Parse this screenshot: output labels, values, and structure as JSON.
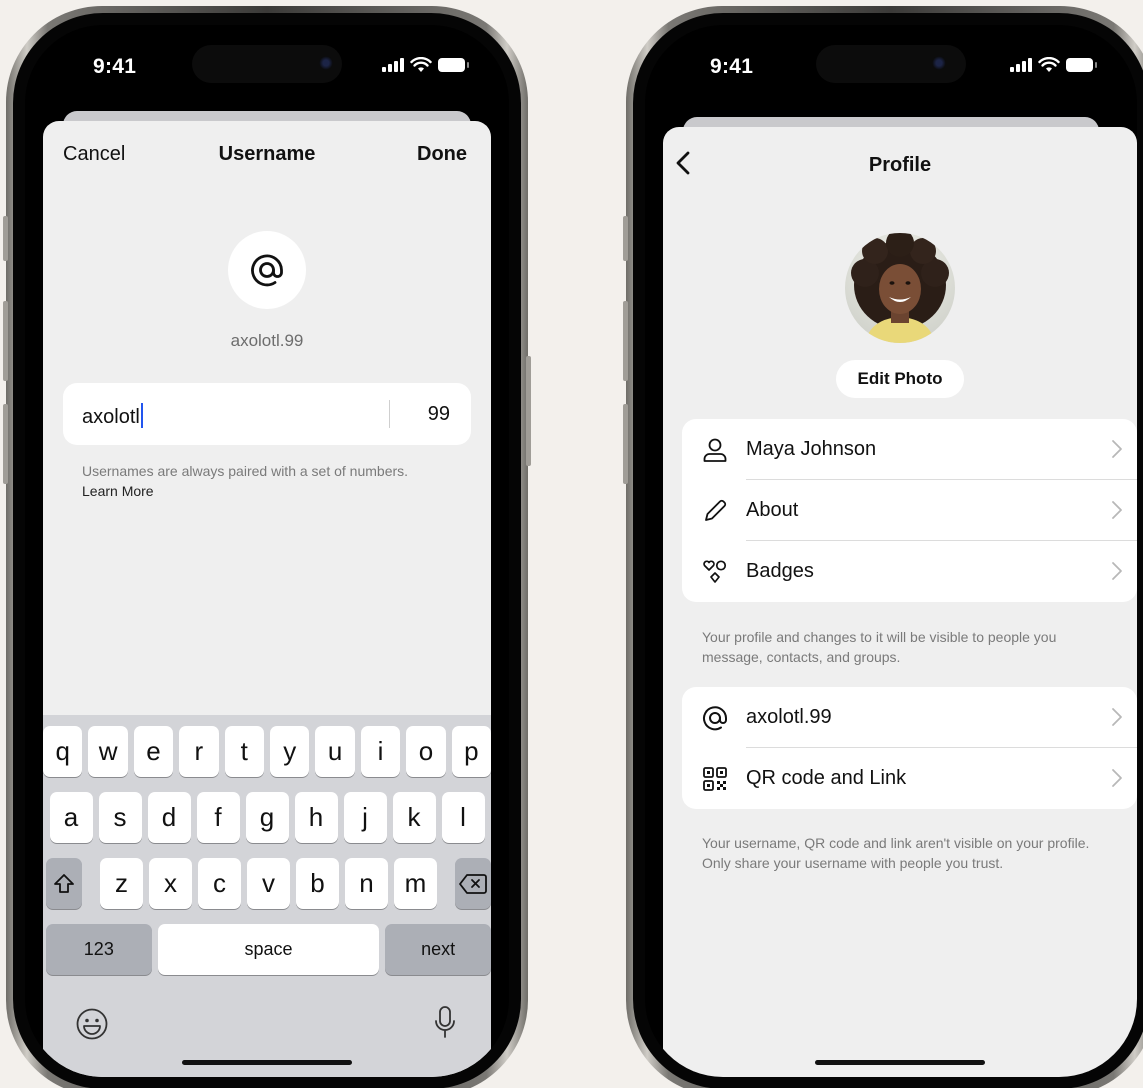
{
  "left_phone": {
    "status": {
      "time": "9:41"
    },
    "nav": {
      "cancel": "Cancel",
      "title": "Username",
      "done": "Done"
    },
    "username_display": "axolotl.99",
    "input": {
      "value": "axolotl",
      "number": "99"
    },
    "hint": {
      "text": "Usernames are always paired with a set of numbers.",
      "link": "Learn More"
    },
    "keyboard": {
      "row1": [
        "q",
        "w",
        "e",
        "r",
        "t",
        "y",
        "u",
        "i",
        "o",
        "p"
      ],
      "row2": [
        "a",
        "s",
        "d",
        "f",
        "g",
        "h",
        "j",
        "k",
        "l"
      ],
      "row3": [
        "z",
        "x",
        "c",
        "v",
        "b",
        "n",
        "m"
      ],
      "numbers_key": "123",
      "space_key": "space",
      "next_key": "next"
    }
  },
  "right_phone": {
    "status": {
      "time": "9:41"
    },
    "nav": {
      "title": "Profile"
    },
    "edit_photo": "Edit Photo",
    "profile_items": [
      {
        "label": "Maya Johnson",
        "icon": "person-icon"
      },
      {
        "label": "About",
        "icon": "pencil-icon"
      },
      {
        "label": "Badges",
        "icon": "badges-icon"
      }
    ],
    "profile_note": "Your profile and changes to it will be visible to people you message, contacts, and groups.",
    "username_items": [
      {
        "label": "axolotl.99",
        "icon": "at-icon"
      },
      {
        "label": "QR code and Link",
        "icon": "qr-code-icon"
      }
    ],
    "username_note": "Your username, QR code and link aren't visible on your profile. Only share your username with people you trust."
  }
}
